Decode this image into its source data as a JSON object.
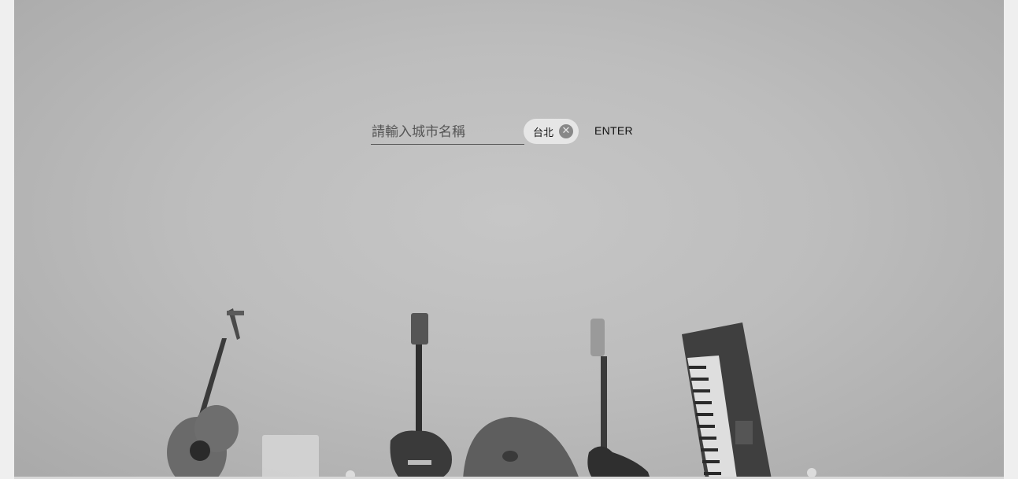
{
  "search": {
    "placeholder": "請輸入城市名稱",
    "value": ""
  },
  "chips": [
    {
      "label": "台北",
      "close_icon": "close-circle-icon"
    }
  ],
  "actions": {
    "enter_label": "ENTER"
  },
  "background": {
    "icon": "instruments-photo",
    "tone": "#bdbdbd"
  }
}
